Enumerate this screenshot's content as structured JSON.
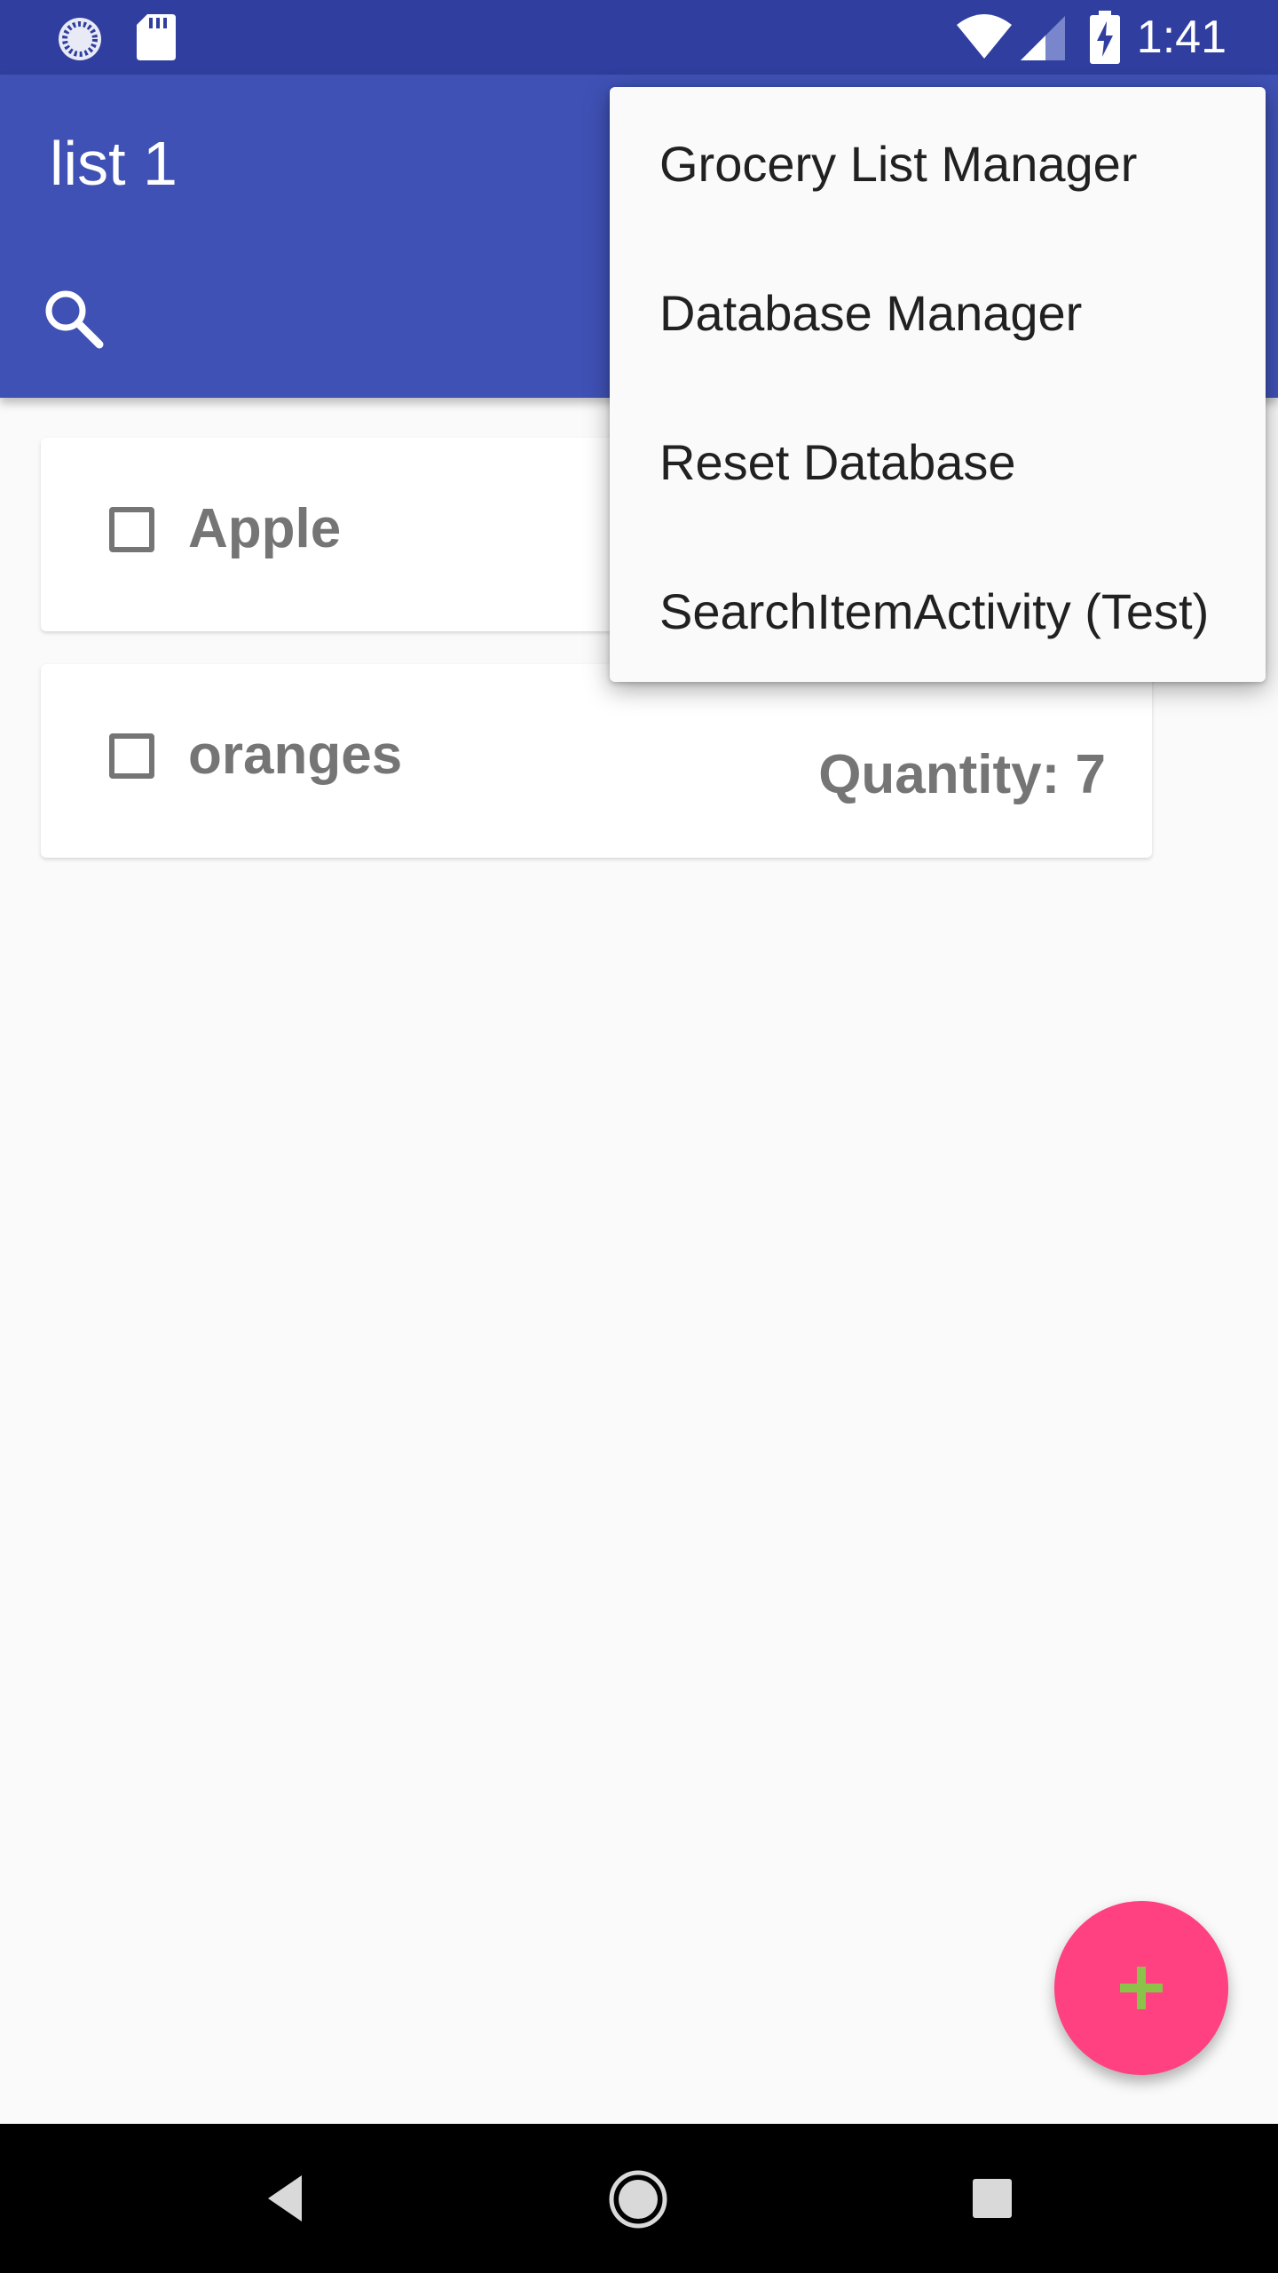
{
  "status_bar": {
    "time": "1:41",
    "icons": [
      "sync-icon",
      "sd-card-icon",
      "wifi-icon",
      "signal-icon",
      "battery-charging-icon"
    ]
  },
  "toolbar": {
    "title": "list 1",
    "search_icon": "search-icon"
  },
  "items": [
    {
      "name": "Apple",
      "checked": false
    },
    {
      "name": "oranges",
      "quantity": "Quantity: 7",
      "checked": false
    }
  ],
  "overflow_menu": {
    "items": [
      "Grocery List Manager",
      "Database Manager",
      "Reset Database",
      "SearchItemActivity (Test)"
    ]
  },
  "fab": {
    "icon": "plus-icon"
  },
  "nav_bar": {
    "buttons": [
      "back-icon",
      "home-icon",
      "recents-icon"
    ]
  },
  "colors": {
    "primary": "#3f51b5",
    "primary_dark": "#303f9f",
    "accent": "#ff4081",
    "fab_plus": "#8bc34a",
    "text_secondary": "#757575"
  }
}
